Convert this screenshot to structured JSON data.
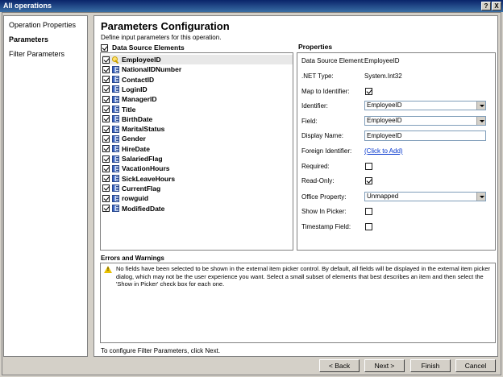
{
  "window": {
    "title": "All operations",
    "help_label": "?",
    "close_label": "X"
  },
  "nav": {
    "items": [
      {
        "label": "Operation Properties",
        "active": false
      },
      {
        "label": "Parameters",
        "active": true
      },
      {
        "label": "Filter Parameters",
        "active": false
      }
    ]
  },
  "main": {
    "title": "Parameters Configuration",
    "description": "Define input parameters for this operation.",
    "data_source_header": "Data Source Elements",
    "elements": [
      {
        "label": "EmployeeID",
        "checked": true,
        "icon": "key-icon",
        "selected": true
      },
      {
        "label": "NationalIDNumber",
        "checked": true,
        "icon": "field-icon"
      },
      {
        "label": "ContactID",
        "checked": true,
        "icon": "field-icon"
      },
      {
        "label": "LoginID",
        "checked": true,
        "icon": "field-icon"
      },
      {
        "label": "ManagerID",
        "checked": true,
        "icon": "field-icon"
      },
      {
        "label": "Title",
        "checked": true,
        "icon": "field-icon"
      },
      {
        "label": "BirthDate",
        "checked": true,
        "icon": "field-icon"
      },
      {
        "label": "MaritalStatus",
        "checked": true,
        "icon": "field-icon"
      },
      {
        "label": "Gender",
        "checked": true,
        "icon": "field-icon"
      },
      {
        "label": "HireDate",
        "checked": true,
        "icon": "field-icon"
      },
      {
        "label": "SalariedFlag",
        "checked": true,
        "icon": "field-icon"
      },
      {
        "label": "VacationHours",
        "checked": true,
        "icon": "field-icon"
      },
      {
        "label": "SickLeaveHours",
        "checked": true,
        "icon": "field-icon"
      },
      {
        "label": "CurrentFlag",
        "checked": true,
        "icon": "field-icon"
      },
      {
        "label": "rowguid",
        "checked": true,
        "icon": "field-icon"
      },
      {
        "label": "ModifiedDate",
        "checked": true,
        "icon": "field-icon"
      }
    ]
  },
  "properties": {
    "title": "Properties",
    "data_source_element": {
      "label": "Data Source Element:",
      "value": "EmployeeID"
    },
    "net_type": {
      "label": ".NET Type:",
      "value": "System.Int32"
    },
    "map_to_identifier": {
      "label": "Map to Identifier:",
      "checked": true
    },
    "identifier": {
      "label": "Identifier:",
      "value": "EmployeeID"
    },
    "field": {
      "label": "Field:",
      "value": "EmployeeID"
    },
    "display_name": {
      "label": "Display Name:",
      "value": "EmployeeID"
    },
    "foreign_identifier": {
      "label": "Foreign Identifier:",
      "link": "(Click to Add)"
    },
    "required": {
      "label": "Required:",
      "checked": false
    },
    "read_only": {
      "label": "Read-Only:",
      "checked": true
    },
    "office_property": {
      "label": "Office Property:",
      "value": "Unmapped"
    },
    "show_in_picker": {
      "label": "Show In Picker:",
      "checked": false
    },
    "timestamp_field": {
      "label": "Timestamp Field:",
      "checked": false
    }
  },
  "errors": {
    "title": "Errors and Warnings",
    "message": "No fields have been selected to be shown in the external item picker control. By default, all fields will be displayed in the external item picker dialog, which may not be the user experience you want. Select a small subset of elements that best describes an item and then select the 'Show in Picker' check box for each one."
  },
  "footer": {
    "note": "To configure Filter Parameters, click Next.",
    "back_label": "< Back",
    "next_label": "Next >",
    "finish_label": "Finish",
    "cancel_label": "Cancel"
  }
}
